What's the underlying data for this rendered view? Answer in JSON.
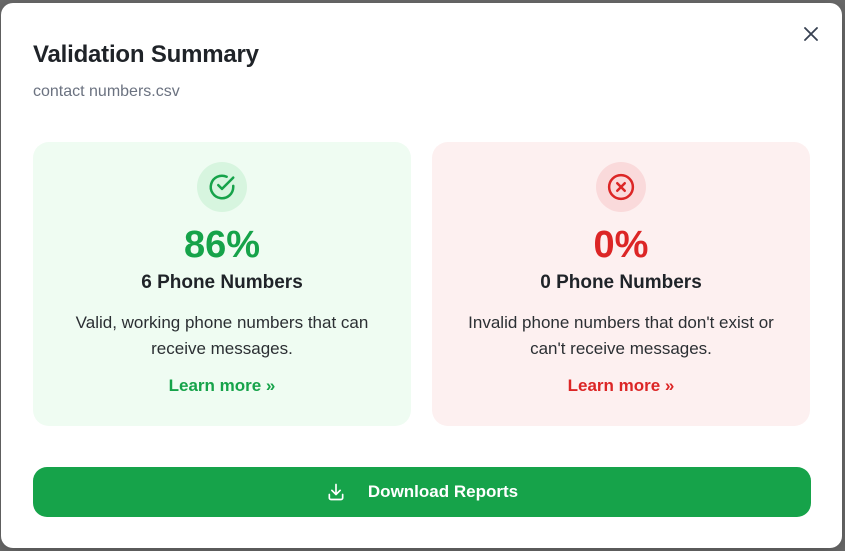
{
  "modal": {
    "title": "Validation Summary",
    "subtitle": "contact numbers.csv",
    "close_icon": "close-icon"
  },
  "cards": {
    "valid": {
      "icon": "check-circle-icon",
      "percent": "86%",
      "count": "6 Phone Numbers",
      "description": "Valid, working phone numbers that can receive messages.",
      "learn_more": "Learn more »",
      "color": "#16a34a",
      "bg": "#effcf2"
    },
    "invalid": {
      "icon": "x-circle-icon",
      "percent": "0%",
      "count": "0 Phone Numbers",
      "description": "Invalid phone numbers that don't exist or can't receive messages.",
      "learn_more": "Learn more »",
      "color": "#dc2626",
      "bg": "#fdf0f0"
    }
  },
  "actions": {
    "download_label": "Download Reports",
    "download_icon": "download-icon",
    "color": "#16a34a"
  }
}
